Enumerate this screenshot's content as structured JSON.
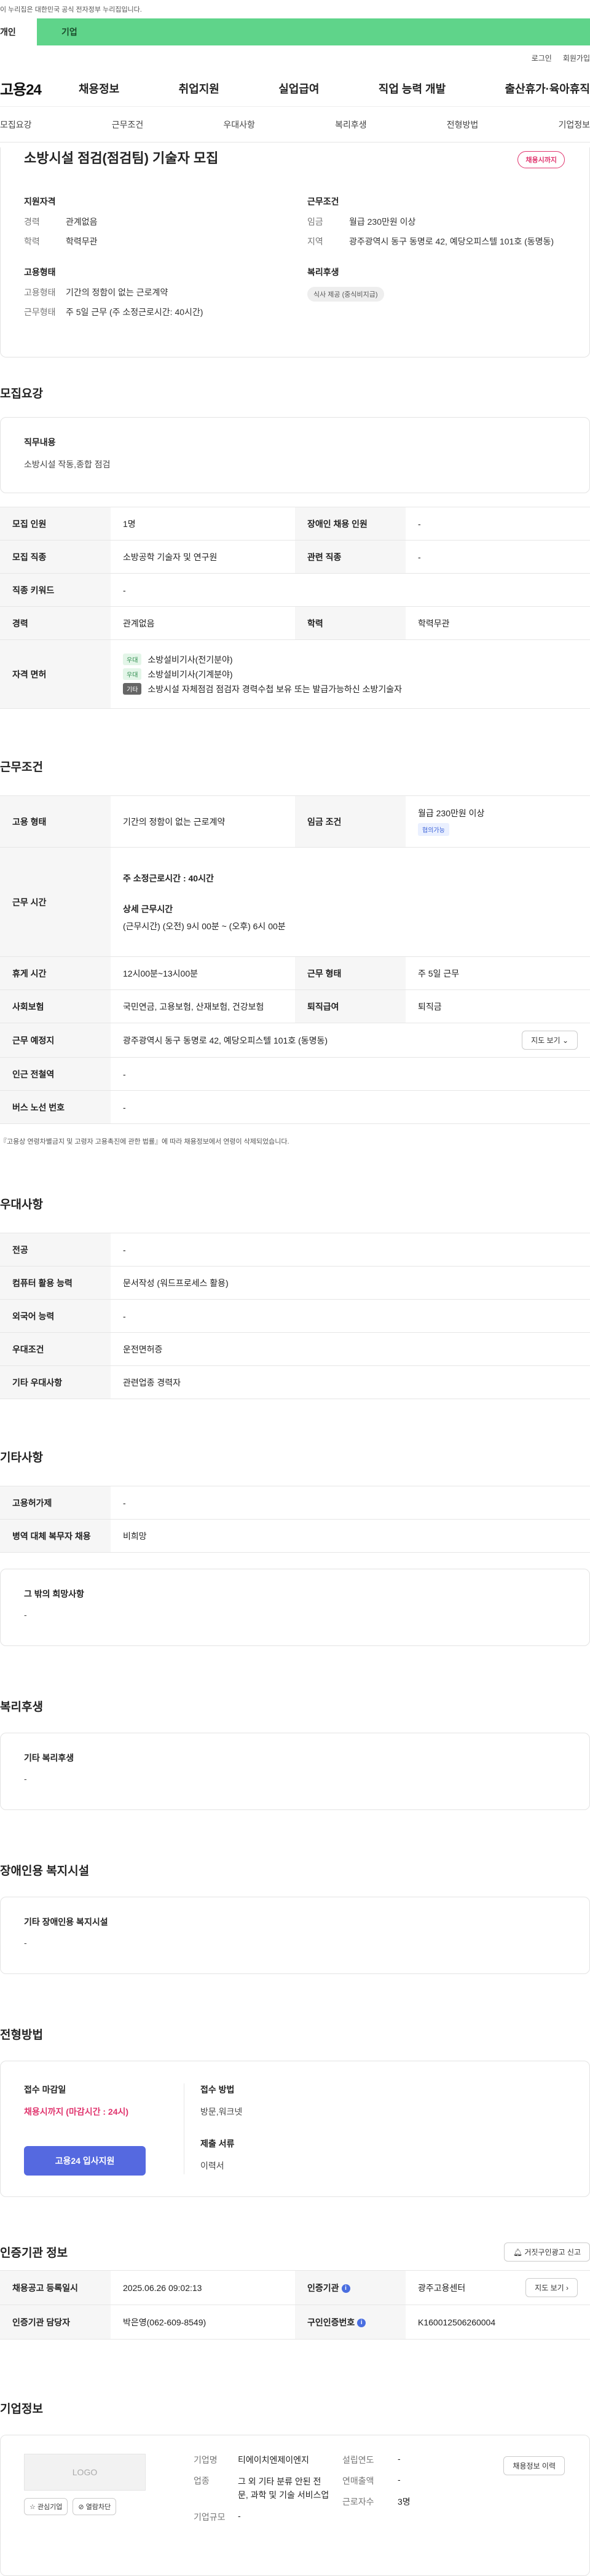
{
  "gov_notice": "이 누리집은 대한민국 공식 전자정부 누리집입니다.",
  "user_tabs": {
    "personal": "개인",
    "company": "기업"
  },
  "util": {
    "login": "로그인",
    "signup": "회원가입"
  },
  "logo": "고용24",
  "gnb": [
    "채용정보",
    "취업지원",
    "실업급여",
    "직업 능력 개발",
    "출산휴가·육아휴직"
  ],
  "subnav": [
    "모집요강",
    "근무조건",
    "우대사항",
    "복리후생",
    "전형방법",
    "기업정보"
  ],
  "summary": {
    "title": "소방시설 점검(점검팀) 기술자 모집",
    "deadline_badge": "채용시까지",
    "qual_h": "지원자격",
    "career_k": "경력",
    "career_v": "관계없음",
    "edu_k": "학력",
    "edu_v": "학력무관",
    "emp_h": "고용형태",
    "emp_type_k": "고용형태",
    "emp_type_v": "기간의 정함이 없는 근로계약",
    "work_form_k": "근무형태",
    "work_form_v": "주 5일 근무 (주 소정근로시간: 40시간)",
    "cond_h": "근무조건",
    "wage_k": "임금",
    "wage_v": "월급 230만원 이상",
    "region_k": "지역",
    "region_v": "광주광역시 동구 동명로 42, 예당오피스텔 101호 (동명동)",
    "welfare_h": "복리후생",
    "welfare_chip": "식사 제공 (중식비지급)"
  },
  "recruit": {
    "title": "모집요강",
    "duty_h": "직무내용",
    "duty_v": "소방시설 작동,종합 점검",
    "rows": {
      "headcount_k": "모집 인원",
      "headcount_v": "1명",
      "disabled_k": "장애인 채용 인원",
      "disabled_v": "-",
      "job_k": "모집 직종",
      "job_v": "소방공학 기술자 및 연구원",
      "related_k": "관련 직종",
      "related_v": "-",
      "keyword_k": "직종 키워드",
      "keyword_v": "-",
      "career_k": "경력",
      "career_v": "관계없음",
      "edu_k": "학력",
      "edu_v": "학력무관",
      "license_k": "자격 면허"
    },
    "licenses": [
      {
        "tag": "우대",
        "text": "소방설비기사(전기분야)"
      },
      {
        "tag": "우대",
        "text": "소방설비기사(기계분야)"
      },
      {
        "tag": "기타",
        "text": "소방시설 자체점검 점검자 경력수첩 보유 또는 발급가능하신 소방기술자"
      }
    ]
  },
  "work": {
    "title": "근무조건",
    "emp_k": "고용 형태",
    "emp_v": "기간의 정함이 없는 근로계약",
    "wage_k": "임금 조건",
    "wage_v": "월급 230만원 이상",
    "wage_tag": "협의가능",
    "hours_k": "근무 시간",
    "hours_main": "주 소정근로시간 : 40시간",
    "hours_detail_h": "상세 근무시간",
    "hours_detail_v": "(근무시간) (오전) 9시 00분 ~ (오후) 6시 00분",
    "break_k": "휴게 시간",
    "break_v": "12시00분~13시00분",
    "form_k": "근무 형태",
    "form_v": "주 5일 근무",
    "insurance_k": "사회보험",
    "insurance_v": "국민연금, 고용보험, 산재보험, 건강보험",
    "retire_k": "퇴직급여",
    "retire_v": "퇴직금",
    "place_k": "근무 예정지",
    "place_v": "광주광역시 동구 동명로 42, 예당오피스텔 101호 (동명동)",
    "map_btn": "지도 보기",
    "subway_k": "인근 전철역",
    "subway_v": "-",
    "bus_k": "버스 노선 번호",
    "bus_v": "-",
    "note": "『고용상 연령차별금지 및 고령자 고용촉진에 관한 법률』에 따라 채용정보에서 연령이 삭제되었습니다."
  },
  "prefer": {
    "title": "우대사항",
    "major_k": "전공",
    "major_v": "-",
    "pc_k": "컴퓨터 활용 능력",
    "pc_v": "문서작성 (워드프로세스 활용)",
    "lang_k": "외국어 능력",
    "lang_v": "-",
    "cond_k": "우대조건",
    "cond_v": "운전면허증",
    "etc_k": "기타 우대사항",
    "etc_v": "관련업종 경력자"
  },
  "etc": {
    "title": "기타사항",
    "support_k": "고용허가제",
    "support_v": "-",
    "military_k": "병역 대체 복무자 채용",
    "military_v": "비희망",
    "wish_h": "그 밖의 희망사항",
    "wish_v": "-"
  },
  "welfare": {
    "title": "복리후생",
    "h": "기타 복리후생",
    "v": "-"
  },
  "disabled_fac": {
    "title": "장애인용 복지시설",
    "h": "기타 장애인용 복지시설",
    "v": "-"
  },
  "screening": {
    "title": "전형방법",
    "deadline_h": "접수 마감일",
    "deadline_v": "채용시까지 (마감시간 : 24시)",
    "apply_btn": "고용24 입사지원",
    "method_h": "접수 방법",
    "method_v": "방문,워크넷",
    "docs_h": "제출 서류",
    "docs_v": "이력서"
  },
  "cert": {
    "title": "인증기관 정보",
    "report_btn": "거짓구인광고 신고",
    "reg_k": "채용공고 등록일시",
    "reg_v": "2025.06.26 09:02:13",
    "agency_k": "인증기관",
    "agency_v": "광주고용센터",
    "map_btn": "지도 보기",
    "manager_k": "인증기관 담당자",
    "manager_v": "박은영(062-609-8549)",
    "num_k": "구인인증번호",
    "num_v": "K160012506260004"
  },
  "company": {
    "title": "기업정보",
    "logo_text": "LOGO",
    "fav_btn": "관심기업",
    "block_btn": "열람차단",
    "name_k": "기업명",
    "name_v": "티에이치엔제이엔지",
    "industry_k": "업종",
    "industry_v": "그 외 기타 분류 안된 전문, 과학 및 기술 서비스업",
    "size_k": "기업규모",
    "size_v": "-",
    "year_k": "설립연도",
    "year_v": "-",
    "sales_k": "연매출액",
    "sales_v": "-",
    "staff_k": "근로자수",
    "staff_v": "3명",
    "history_btn": "채용정보 이력"
  }
}
